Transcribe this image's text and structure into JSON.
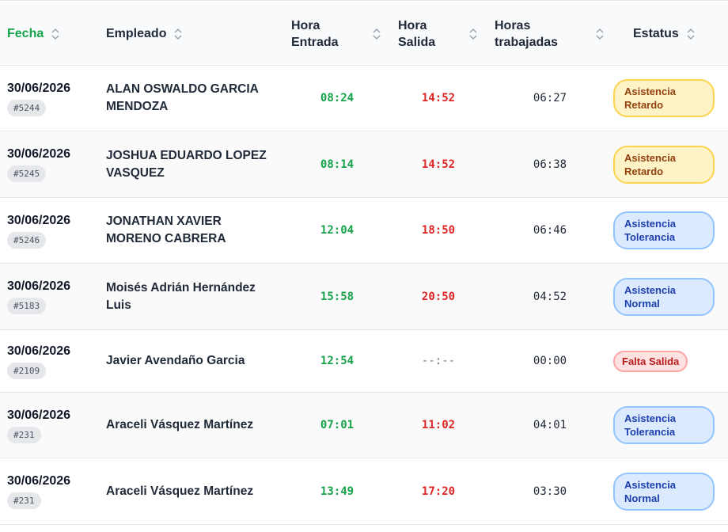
{
  "header": {
    "fecha": "Fecha",
    "empleado": "Empleado",
    "hora_entrada_1": "Hora",
    "hora_entrada_2": "Entrada",
    "hora_salida_1": "Hora",
    "hora_salida_2": "Salida",
    "horas_trab_1": "Horas",
    "horas_trab_2": "trabajadas",
    "estatus": "Estatus"
  },
  "rows": [
    {
      "fecha": "30/06/2026",
      "id": "#5244",
      "empleado": "ALAN OSWALDO GARCIA MENDOZA",
      "entrada": "08:24",
      "salida": "14:52",
      "horas": "06:27",
      "status1": "Asistencia",
      "status2": "Retardo"
    },
    {
      "fecha": "30/06/2026",
      "id": "#5245",
      "empleado": "JOSHUA EDUARDO LOPEZ VASQUEZ",
      "entrada": "08:14",
      "salida": "14:52",
      "horas": "06:38",
      "status1": "Asistencia",
      "status2": "Retardo"
    },
    {
      "fecha": "30/06/2026",
      "id": "#5246",
      "empleado": "JONATHAN XAVIER MORENO CABRERA",
      "entrada": "12:04",
      "salida": "18:50",
      "horas": "06:46",
      "status1": "Asistencia",
      "status2": "Tolerancia"
    },
    {
      "fecha": "30/06/2026",
      "id": "#5183",
      "empleado": "Moisés Adrián Hernández Luis",
      "entrada": "15:58",
      "salida": "20:50",
      "horas": "04:52",
      "status1": "Asistencia",
      "status2": "Normal"
    },
    {
      "fecha": "30/06/2026",
      "id": "#2109",
      "empleado": "Javier Avendaño Garcia",
      "entrada": "12:54",
      "salida": "--:--",
      "horas": "00:00",
      "status1": "Falta Salida",
      "status2": ""
    },
    {
      "fecha": "30/06/2026",
      "id": "#231",
      "empleado": "Araceli Vásquez Martínez",
      "entrada": "07:01",
      "salida": "11:02",
      "horas": "04:01",
      "status1": "Asistencia",
      "status2": "Tolerancia"
    },
    {
      "fecha": "30/06/2026",
      "id": "#231",
      "empleado": "Araceli Vásquez Martínez",
      "entrada": "13:49",
      "salida": "17:20",
      "horas": "03:30",
      "status1": "Asistencia",
      "status2": "Normal"
    }
  ],
  "colors": {
    "active_sort": "#16a34a",
    "entrada": "#16a34a",
    "salida": "#dc2626",
    "retardo_bg": "#fef3c7",
    "normal_bg": "#dbeafe",
    "falta_bg": "#fee2e2"
  },
  "icons": {
    "sort": "sort-updown-icon"
  }
}
